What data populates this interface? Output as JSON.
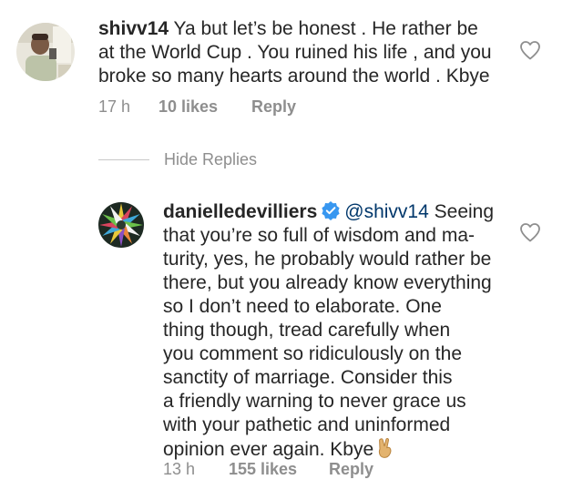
{
  "comment": {
    "username": "shivv14",
    "lines": [
      "Ya but let’s be honest . He rather be",
      "at the World Cup . You ruined his life , and you",
      "broke so many hearts around the world . Kbye"
    ],
    "time": "17 h",
    "likes": "10 likes",
    "reply_label": "Reply"
  },
  "thread": {
    "toggle_label": "Hide Replies"
  },
  "reply": {
    "username": "danielledevilliers",
    "verified": true,
    "mention": "@shivv14",
    "first_line_rest": " Seeing",
    "lines": [
      "that you’re so full of wisdom and ma-",
      "turity, yes, he probably would rather be",
      "there, but you already know everything",
      "so I don’t need to elaborate. One",
      "thing though, tread carefully when",
      "you comment so ridiculously on the",
      "sanctity of marriage. Consider this",
      "a friendly warning to never grace us",
      "with your pathetic and uninformed",
      "opinion ever again. Kbye"
    ],
    "emoji": "victory-hand",
    "time": "13 h",
    "likes": "155 likes",
    "reply_label": "Reply"
  },
  "colors": {
    "text": "#262626",
    "meta": "#8e8e8e",
    "mention": "#00376b",
    "verified": "#3897f0"
  }
}
